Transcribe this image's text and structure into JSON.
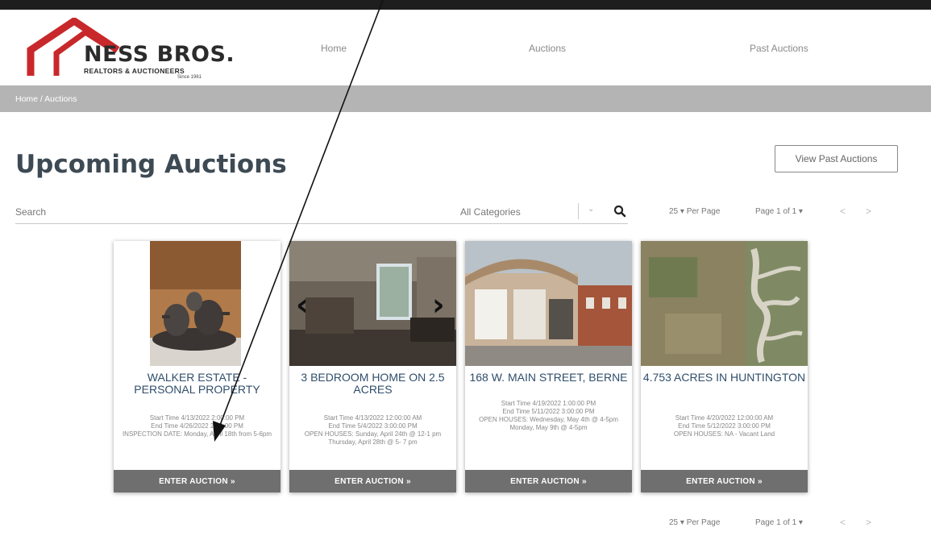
{
  "brand": {
    "name": "NESS BROS.",
    "subtitle": "REALTORS & AUCTIONEERS",
    "since": "Since 1961",
    "roof_color": "#c8282b"
  },
  "nav": {
    "home": "Home",
    "auctions": "Auctions",
    "past_auctions": "Past Auctions"
  },
  "breadcrumb": "Home / Auctions",
  "page_title": "Upcoming Auctions",
  "view_past_button": "View Past Auctions",
  "search": {
    "placeholder": "Search",
    "category": "All Categories"
  },
  "pagination": {
    "per_page_value": "25",
    "per_page_label": "Per Page",
    "page_label": "Page 1 of 1",
    "prev": "<",
    "next": ">"
  },
  "cards": [
    {
      "title": "WALKER ESTATE - PERSONAL PROPERTY",
      "start": "Start Time 4/13/2022 2:00:00 PM",
      "end": "End Time 4/26/2022 2:00:00 PM",
      "note": "INSPECTION DATE: Monday, April 18th from 5-6pm",
      "button": "ENTER AUCTION »"
    },
    {
      "title": "3 BEDROOM HOME ON 2.5 ACRES",
      "start": "Start Time 4/13/2022 12:00:00 AM",
      "end": "End Time 5/4/2022 3:00:00 PM",
      "note": "OPEN HOUSES: Sunday, April 24th @ 12-1 pm Thursday, April 28th @ 5- 7 pm",
      "button": "ENTER AUCTION »"
    },
    {
      "title": "168 W. MAIN STREET, BERNE",
      "start": "Start Time 4/19/2022 1:00:00 PM",
      "end": "End Time 5/11/2022 3:00:00 PM",
      "note": "OPEN HOUSES: Wednesday, May 4th @ 4-5pm Monday, May 9th @ 4-5pm",
      "button": "ENTER AUCTION »"
    },
    {
      "title": "4.753 ACRES IN HUNTINGTON",
      "start": "Start Time 4/20/2022 12:00:00 AM",
      "end": "End Time 5/12/2022 3:00:00 PM",
      "note": "OPEN HOUSES: NA - Vacant Land",
      "button": "ENTER AUCTION »"
    }
  ]
}
